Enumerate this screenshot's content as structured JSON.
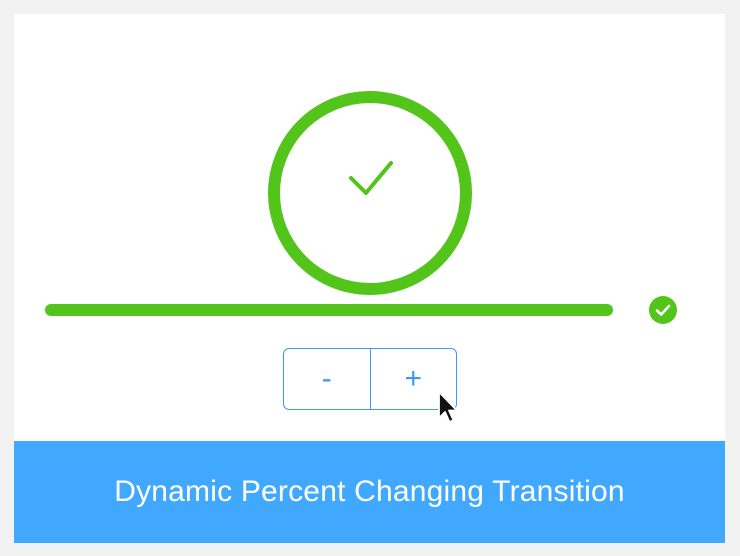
{
  "circle_progress": {
    "percent": 100,
    "status": "success",
    "status_icon": "check-icon"
  },
  "line_progress": {
    "percent": 100,
    "status": "success",
    "status_icon": "check-circle-icon"
  },
  "controls": {
    "decrease_label": "-",
    "increase_label": "+"
  },
  "footer": {
    "title": "Dynamic Percent Changing Transition"
  },
  "colors": {
    "success": "#52c41a",
    "primary": "#4096ff",
    "banner": "#40a9ff",
    "track": "#ececec"
  }
}
